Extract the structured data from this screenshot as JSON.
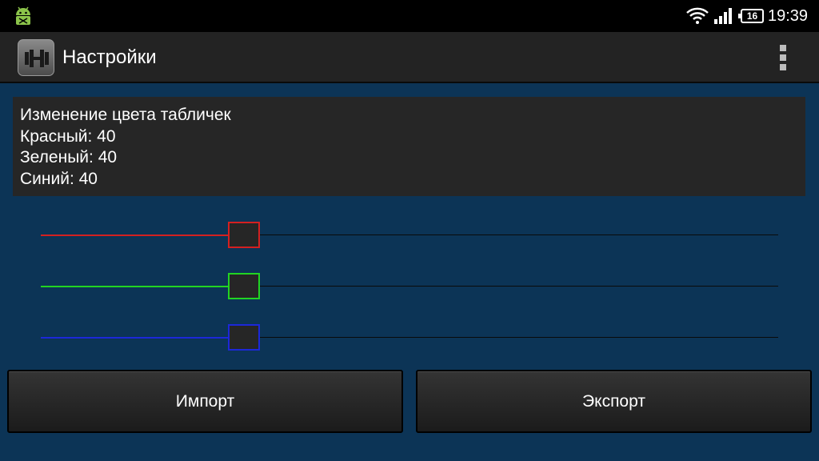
{
  "status_bar": {
    "time": "19:39",
    "battery_level": "16"
  },
  "action_bar": {
    "title": "Настройки"
  },
  "info": {
    "heading": "Изменение цвета табличек",
    "red_line": "Красный: 40",
    "green_line": "Зеленый: 40",
    "blue_line": "Синий: 40"
  },
  "sliders": [
    {
      "name": "red",
      "value": 40,
      "max": 255,
      "color": "#d42020"
    },
    {
      "name": "green",
      "value": 40,
      "max": 255,
      "color": "#22d422"
    },
    {
      "name": "blue",
      "value": 40,
      "max": 255,
      "color": "#1c28d8"
    }
  ],
  "buttons": {
    "import_label": "Импорт",
    "export_label": "Экспорт"
  }
}
